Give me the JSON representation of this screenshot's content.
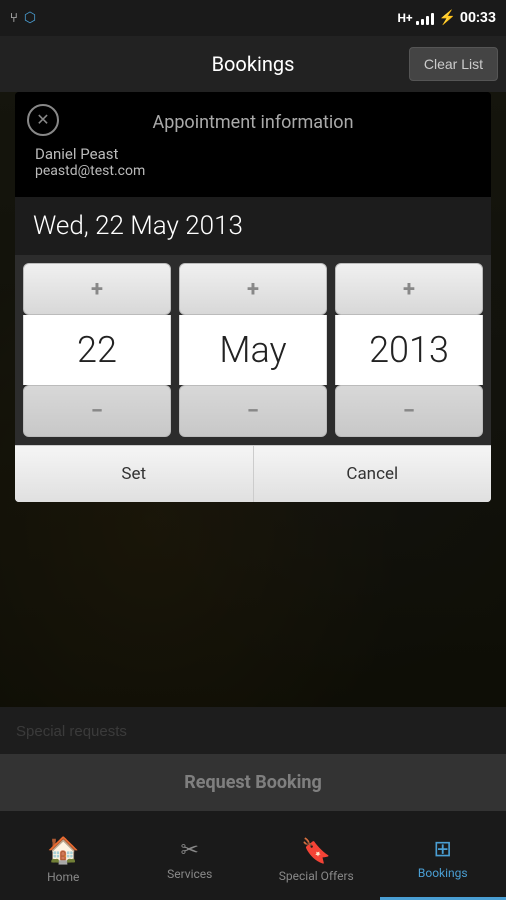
{
  "statusBar": {
    "time": "00:33",
    "signal": "H+",
    "battery": "⚡"
  },
  "topBar": {
    "title": "Bookings",
    "clearListLabel": "Clear List"
  },
  "dialog": {
    "closeIcon": "✕",
    "titleLabel": "Appointment information",
    "userName": "Daniel Peast",
    "userEmail": "peastd@test.com",
    "dateDisplay": "Wed, 22 May 2013",
    "dayValue": "22",
    "monthValue": "May",
    "yearValue": "2013",
    "plusIcon": "+",
    "minusIcon": "−",
    "setLabel": "Set",
    "cancelLabel": "Cancel"
  },
  "bottomContent": {
    "specialRequestsPlaceholder": "Special requests"
  },
  "requestBookingBtn": {
    "label": "Request Booking"
  },
  "bottomNav": {
    "items": [
      {
        "id": "home",
        "label": "Home",
        "icon": "🏠",
        "active": false
      },
      {
        "id": "services",
        "label": "Services",
        "icon": "✂",
        "active": false
      },
      {
        "id": "special-offers",
        "label": "Special Offers",
        "icon": "🔖",
        "active": false
      },
      {
        "id": "bookings",
        "label": "Bookings",
        "icon": "📅",
        "active": true
      }
    ]
  }
}
